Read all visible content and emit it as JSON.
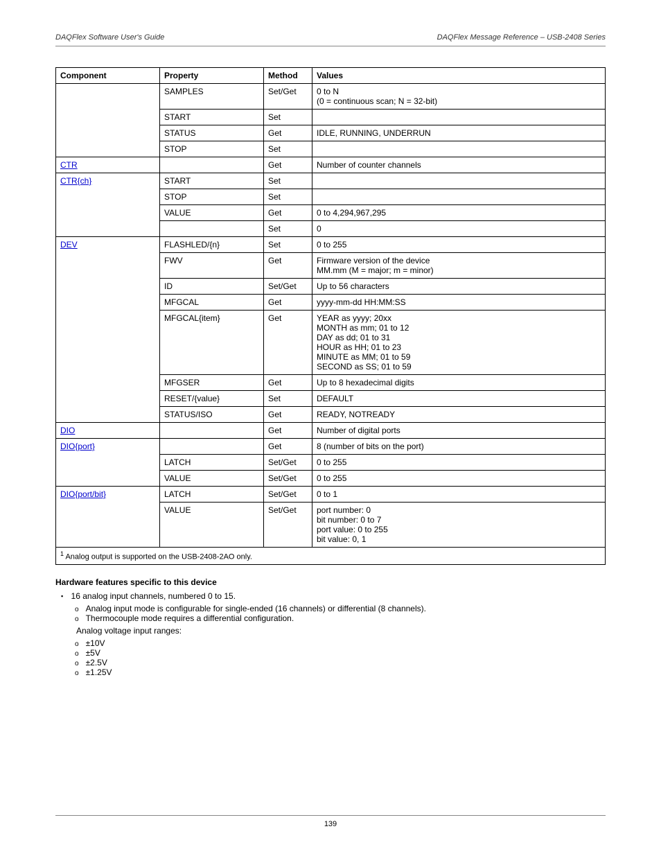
{
  "header": {
    "left": "DAQFlex Software User's Guide",
    "right": "DAQFlex Message Reference – USB-2408 Series"
  },
  "table": {
    "headers": [
      "Component",
      "Property",
      "Method",
      "Values"
    ],
    "rows": [
      {
        "component": "",
        "property": "SAMPLES",
        "method": "Set/Get",
        "values": "0 to N\n(0 = continuous scan; N = 32-bit)",
        "comp_class": "no-top no-bottom"
      },
      {
        "component": "",
        "property": "START",
        "method": "Set",
        "values": "",
        "comp_class": "no-top no-bottom"
      },
      {
        "component": "",
        "property": "STATUS",
        "method": "Get",
        "values": "IDLE, RUNNING, UNDERRUN",
        "comp_class": "no-top no-bottom"
      },
      {
        "component": "",
        "property": "STOP",
        "method": "Set",
        "values": "",
        "comp_class": "no-top"
      },
      {
        "component": "CTR",
        "link": true,
        "property": "",
        "method": "Get",
        "values": "Number of counter channels"
      },
      {
        "component": "CTR{ch}",
        "link": true,
        "property": "START",
        "method": "Set",
        "values": "",
        "comp_class": "no-bottom"
      },
      {
        "component": "",
        "property": "STOP",
        "method": "Set",
        "values": "",
        "comp_class": "no-top no-bottom"
      },
      {
        "component": "",
        "property": "VALUE",
        "method": "Get",
        "values": "0 to 4,294,967,295",
        "comp_class": "no-top no-bottom"
      },
      {
        "component": "",
        "property": "",
        "method": "Set",
        "values": "0",
        "comp_class": "no-top"
      },
      {
        "component": "DEV",
        "link": true,
        "property": "FLASHLED/{n}",
        "method": "Set",
        "values": "0 to 255",
        "comp_class": "no-bottom"
      },
      {
        "component": "",
        "property": "FWV",
        "method": "Get",
        "values": "Firmware version of the device\nMM.mm (M = major; m = minor)",
        "comp_class": "no-top no-bottom"
      },
      {
        "component": "",
        "property": "ID",
        "method": "Set/Get",
        "values": "Up to 56 characters",
        "comp_class": "no-top no-bottom"
      },
      {
        "component": "",
        "property": "MFGCAL",
        "method": "Get",
        "values": "yyyy-mm-dd HH:MM:SS",
        "comp_class": "no-top no-bottom"
      },
      {
        "component": "",
        "property": "MFGCAL{item}",
        "method": "Get",
        "values": "YEAR as yyyy; 20xx\nMONTH as mm; 01 to 12\nDAY as dd; 01 to 31\nHOUR as HH; 01 to 23\nMINUTE as MM; 01 to 59\nSECOND as SS; 01 to 59",
        "comp_class": "no-top no-bottom"
      },
      {
        "component": "",
        "property": "MFGSER",
        "method": "Get",
        "values": "Up to 8 hexadecimal digits",
        "comp_class": "no-top no-bottom"
      },
      {
        "component": "",
        "property": "RESET/{value}",
        "method": "Set",
        "values": "DEFAULT",
        "comp_class": "no-top no-bottom"
      },
      {
        "component": "",
        "property": "STATUS/ISO",
        "method": "Get",
        "values": "READY, NOTREADY",
        "comp_class": "no-top"
      },
      {
        "component": "DIO",
        "link": true,
        "property": "",
        "method": "Get",
        "values": "Number of digital ports"
      },
      {
        "component": "DIO{port}",
        "link": true,
        "property": "",
        "method": "Get",
        "values": "8 (number of bits on the port)",
        "comp_class": "no-bottom"
      },
      {
        "component": "",
        "property": "LATCH",
        "method": "Set/Get",
        "values": "0 to 255",
        "comp_class": "no-top no-bottom"
      },
      {
        "component": "",
        "property": "VALUE",
        "method": "Set/Get",
        "values": "0 to 255",
        "comp_class": "no-top"
      },
      {
        "component": "DIO{port/bit}",
        "link": true,
        "property": "LATCH",
        "method": "Set/Get",
        "values": "0 to 1",
        "comp_class": "no-bottom"
      },
      {
        "component": "",
        "property": "VALUE",
        "method": "Set/Get",
        "values": "port number: 0\nbit number: 0 to 7\nport value: 0 to 255\nbit value: 0, 1",
        "comp_class": "no-top"
      }
    ],
    "footnote": "Analog output is supported on the USB-2408-2AO only.",
    "footnote_sup": "1"
  },
  "hw": {
    "title": "Hardware features specific to this device",
    "main": "16 analog input channels, numbered 0 to 15.",
    "sub1": "Analog input mode is configurable for single-ended (16 channels) or differential (8 channels).",
    "sub2": "Thermocouple mode requires a differential configuration.",
    "ranges_label": "Analog voltage input ranges:",
    "ranges": [
      "±10V",
      "±5V",
      "±2.5V",
      "±1.25V"
    ]
  },
  "footer": "139"
}
